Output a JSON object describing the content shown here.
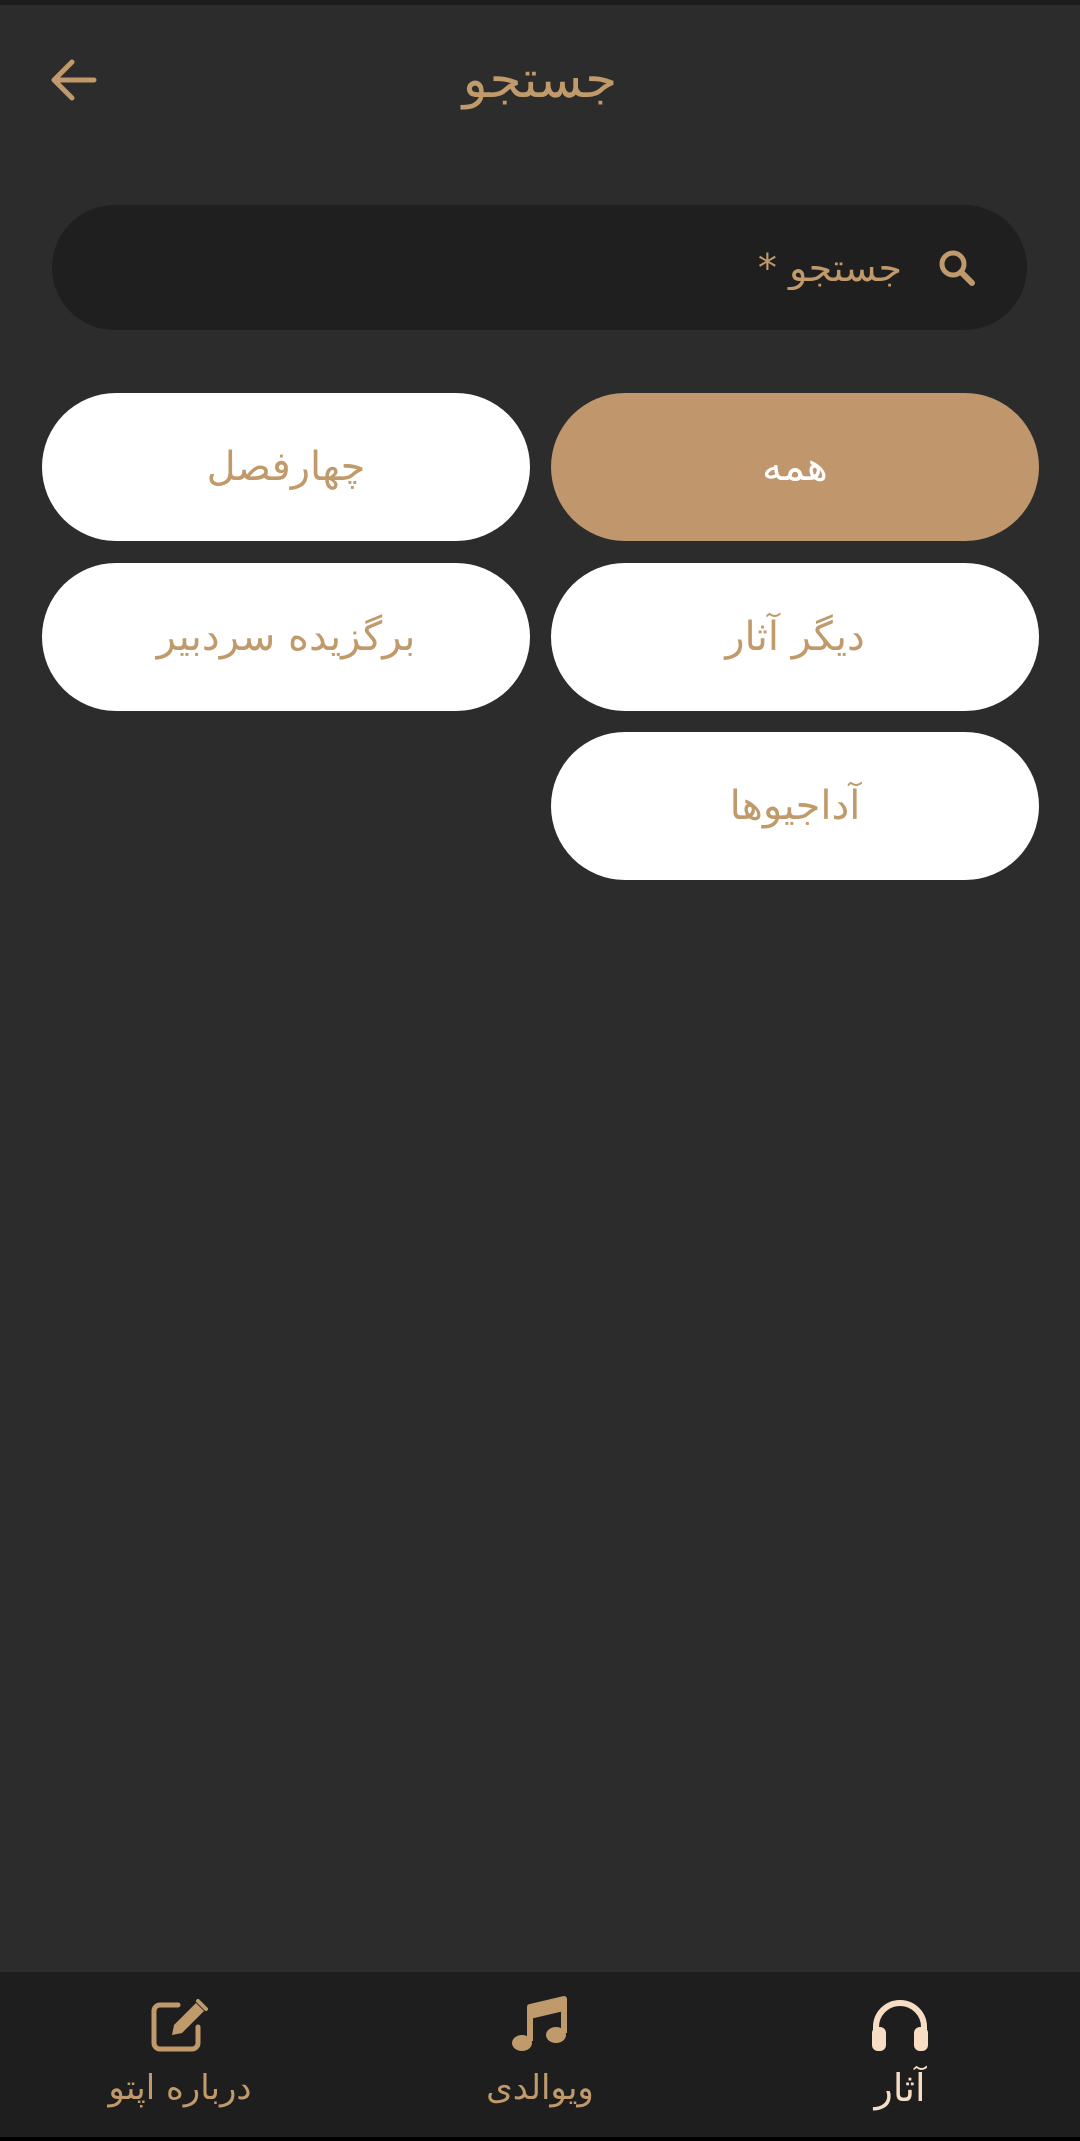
{
  "header": {
    "title": "جستجو",
    "back_icon": "arrow-left-icon"
  },
  "search": {
    "placeholder": "جستجو *",
    "value": "",
    "icon": "search-icon"
  },
  "filters": [
    {
      "label": "همه",
      "active": true
    },
    {
      "label": "چهارفصل",
      "active": false
    },
    {
      "label": "دیگر آثار",
      "active": false
    },
    {
      "label": "برگزیده سردبیر",
      "active": false
    },
    {
      "label": "آداجیوها",
      "active": false
    }
  ],
  "bottom_nav": {
    "items": [
      {
        "label": "آثار",
        "icon": "headphones-icon",
        "active": true
      },
      {
        "label": "ویوالدی",
        "icon": "music-note-icon",
        "active": false
      },
      {
        "label": "درباره اپتو",
        "icon": "edit-icon",
        "active": false
      }
    ]
  },
  "colors": {
    "background": "#2c2c2c",
    "accent": "#c19a6b",
    "chip_active": "#c0976c",
    "chip_inactive": "#ffffff",
    "search_bg": "#1f1f1f",
    "nav_bg": "#1e1e1e",
    "nav_active_label": "#f6ddc3"
  }
}
